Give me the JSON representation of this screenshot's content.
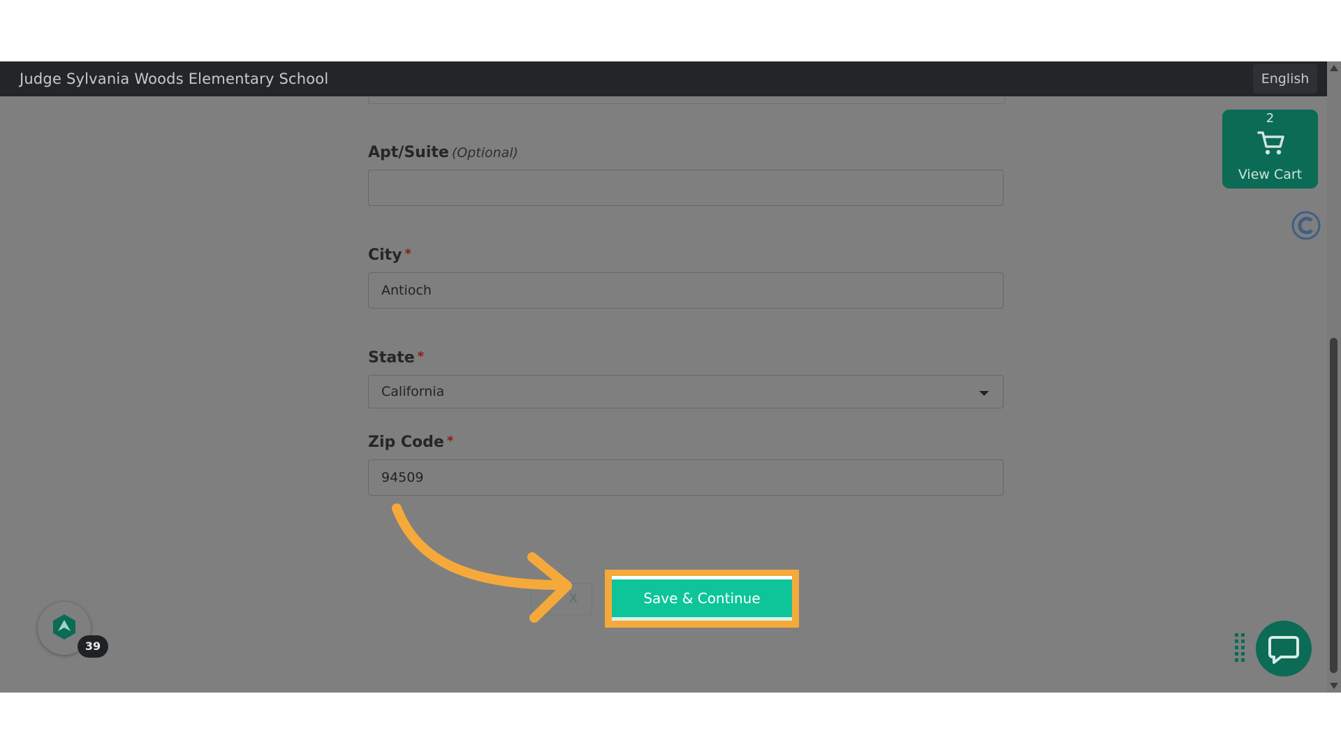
{
  "header": {
    "school_name": "Judge Sylvania Woods Elementary School",
    "language": "English"
  },
  "form": {
    "apt": {
      "label": "Apt/Suite",
      "optional_tag": "(Optional)",
      "value": ""
    },
    "city": {
      "label": "City",
      "required_mark": "*",
      "value": "Antioch"
    },
    "state": {
      "label": "State",
      "required_mark": "*",
      "value": "California"
    },
    "zip": {
      "label": "Zip Code",
      "required_mark": "*",
      "value": "94509"
    }
  },
  "actions": {
    "cancel_label": "X",
    "save_label": "Save & Continue"
  },
  "cart": {
    "count": "2",
    "label": "View Cart"
  },
  "widgets": {
    "badge_count": "39"
  },
  "colors": {
    "accent": "#0ec59a",
    "highlight": "#f6a93b",
    "cart_bg": "#0b6b55",
    "topbar": "#232629"
  },
  "icons": {
    "cart": "shopping-cart-icon",
    "chat": "chat-bubble-icon",
    "tutorial_arrow": "curved-arrow-icon"
  }
}
